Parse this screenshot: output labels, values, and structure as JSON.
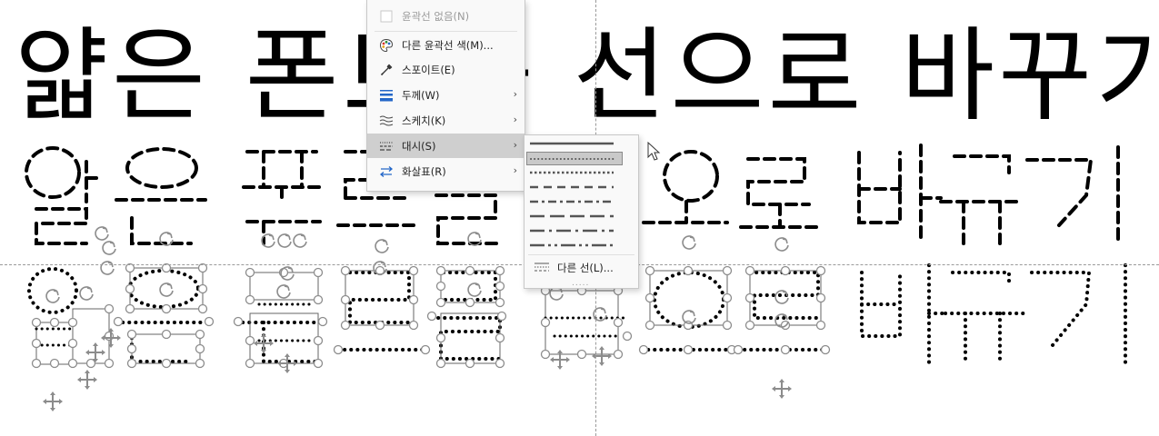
{
  "slide": {
    "row1_text": "얇은 폰트를 선으로 바꾸기"
  },
  "context_menu": {
    "items": [
      {
        "label": "윤곽선 없음(N)",
        "icon": "no-outline-icon",
        "disabled": true
      },
      {
        "label": "다른 윤곽선 색(M)...",
        "icon": "palette-icon"
      },
      {
        "label": "스포이트(E)",
        "icon": "eyedropper-icon"
      },
      {
        "label": "두께(W)",
        "icon": "weight-icon",
        "submenu": true
      },
      {
        "label": "스케치(K)",
        "icon": "sketch-icon",
        "submenu": true
      },
      {
        "label": "대시(S)",
        "icon": "dash-icon",
        "submenu": true,
        "highlighted": true
      },
      {
        "label": "화살표(R)",
        "icon": "arrows-icon",
        "submenu": true
      }
    ]
  },
  "dash_submenu": {
    "styles": [
      "solid",
      "round-dot",
      "square-dot",
      "dash",
      "dash-dot",
      "long-dash",
      "long-dash-dot",
      "long-dash-dot-dot"
    ],
    "selected": "round-dot",
    "more_label": "다른 선(L)...",
    "grip": "....."
  },
  "colors": {
    "menu_bg": "#f9f9f9",
    "highlight": "#cfcfcf",
    "guide": "#9a9a9a",
    "handle": "#8c8c8c"
  }
}
